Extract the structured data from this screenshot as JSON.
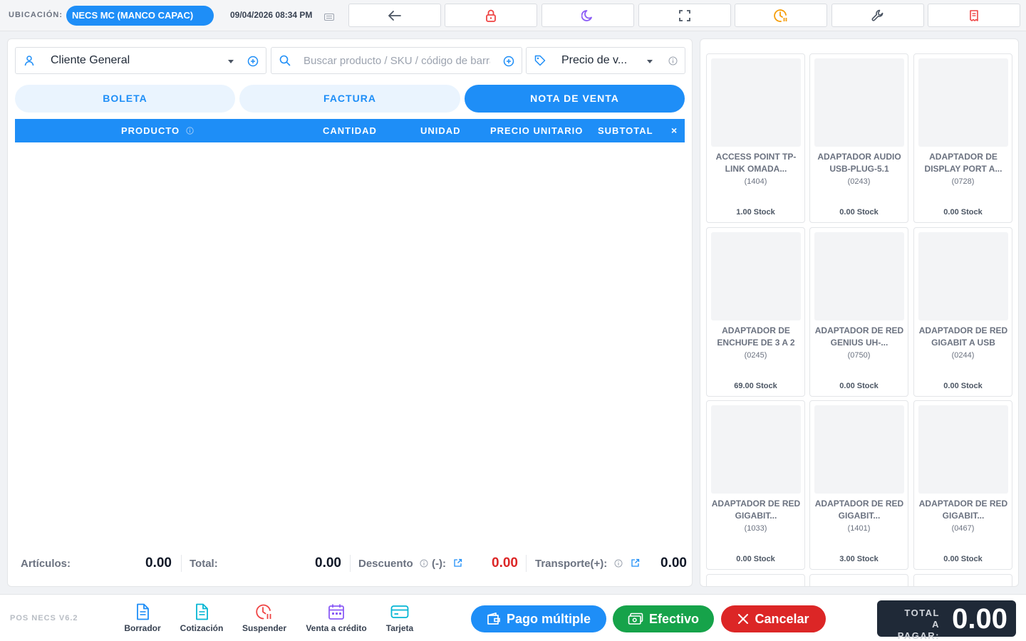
{
  "topbar": {
    "location_label": "UBICACIÓN:",
    "location_value": "NECS MC (MANCO CAPAC)",
    "datetime": "09/04/2026 08:34 PM"
  },
  "toolbar_icons": [
    "back-arrow-icon",
    "lock-icon",
    "moon-icon",
    "fullscreen-icon",
    "clock-pause-icon",
    "wrench-icon",
    "receipt-icon"
  ],
  "colors": {
    "primary": "#1e8ef7",
    "lock": "#ef4444",
    "moon": "#8b5cf6",
    "clock": "#f59e0b",
    "success": "#16a34a",
    "danger": "#dc2626",
    "dark": "#1f2937"
  },
  "customer": {
    "value": "Cliente General"
  },
  "search": {
    "placeholder": "Buscar producto / SKU / código de barras"
  },
  "price_list": {
    "value": "Precio de v..."
  },
  "doc_tabs": [
    {
      "label": "BOLETA",
      "active": false
    },
    {
      "label": "FACTURA",
      "active": false
    },
    {
      "label": "NOTA DE VENTA",
      "active": true
    }
  ],
  "table": {
    "columns": [
      "PRODUCTO",
      "CANTIDAD",
      "UNIDAD",
      "PRECIO UNITARIO",
      "SUBTOTAL",
      "×"
    ]
  },
  "summary": {
    "articles_label": "Artículos:",
    "articles_value": "0.00",
    "total_label": "Total:",
    "total_value": "0.00",
    "discount_label": "Descuento",
    "discount_suffix": "(-):",
    "discount_value": "0.00",
    "transport_label": "Transporte(+):",
    "transport_value": "0.00"
  },
  "products": [
    {
      "name": "ACCESS POINT TP-LINK OMADA...",
      "code": "(1404)",
      "stock": "1.00 Stock"
    },
    {
      "name": "ADAPTADOR AUDIO USB-PLUG-5.1",
      "code": "(0243)",
      "stock": "0.00 Stock"
    },
    {
      "name": "ADAPTADOR DE DISPLAY PORT A...",
      "code": "(0728)",
      "stock": "0.00 Stock"
    },
    {
      "name": "ADAPTADOR DE ENCHUFE DE 3 A 2",
      "code": "(0245)",
      "stock": "69.00 Stock"
    },
    {
      "name": "ADAPTADOR DE RED GENIUS UH-...",
      "code": "(0750)",
      "stock": "0.00 Stock"
    },
    {
      "name": "ADAPTADOR DE RED GIGABIT A USB",
      "code": "(0244)",
      "stock": "0.00 Stock"
    },
    {
      "name": "ADAPTADOR DE RED GIGABIT...",
      "code": "(1033)",
      "stock": "0.00 Stock"
    },
    {
      "name": "ADAPTADOR DE RED GIGABIT...",
      "code": "(1401)",
      "stock": "3.00 Stock"
    },
    {
      "name": "ADAPTADOR DE RED GIGABIT...",
      "code": "(0467)",
      "stock": "0.00 Stock"
    }
  ],
  "bottombar": {
    "version": "POS NECS V6.2",
    "actions": [
      {
        "label": "Borrador",
        "icon": "document-icon"
      },
      {
        "label": "Cotización",
        "icon": "document-list-icon"
      },
      {
        "label": "Suspender",
        "icon": "clock-pause-icon"
      },
      {
        "label": "Venta a crédito",
        "icon": "calendar-icon"
      },
      {
        "label": "Tarjeta",
        "icon": "credit-card-icon"
      }
    ],
    "pay_multiple": "Pago múltiple",
    "pay_cash": "Efectivo",
    "cancel": "Cancelar",
    "total_label_1": "TOTAL",
    "total_label_2": "A PAGAR:",
    "total_value": "0.00"
  }
}
